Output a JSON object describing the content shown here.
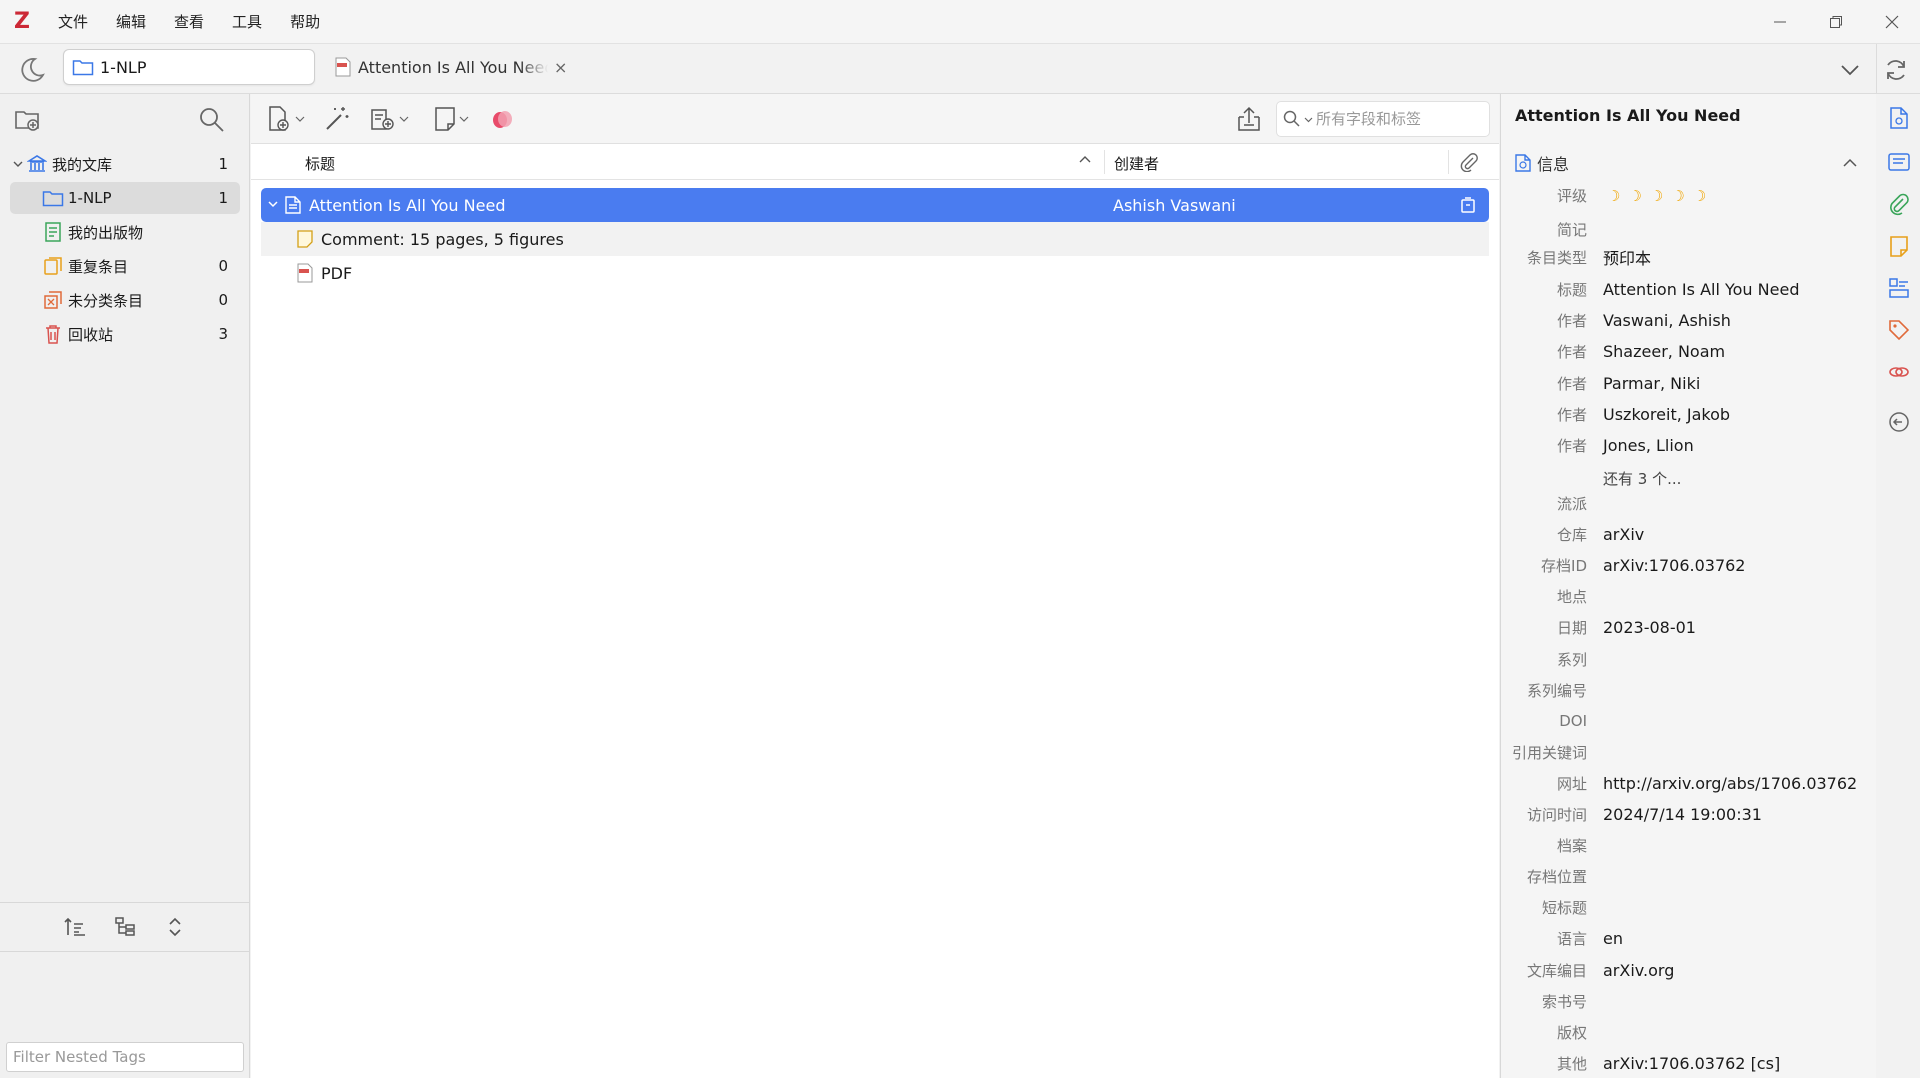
{
  "menubar": {
    "logo": "Z",
    "items": [
      "文件",
      "编辑",
      "查看",
      "工具",
      "帮助"
    ]
  },
  "tabs": {
    "library_tab": "1-NLP",
    "reader_tab": "Attention Is All You Need",
    "close_glyph": "×"
  },
  "collections": [
    {
      "label": "我的文库",
      "count": "1",
      "icon": "library-icon"
    },
    {
      "label": "1-NLP",
      "count": "1",
      "icon": "folder-icon"
    },
    {
      "label": "我的出版物",
      "count": "",
      "icon": "publications-icon"
    },
    {
      "label": "重复条目",
      "count": "0",
      "icon": "duplicates-icon"
    },
    {
      "label": "未分类条目",
      "count": "0",
      "icon": "unfiled-icon"
    },
    {
      "label": "回收站",
      "count": "3",
      "icon": "trash-icon"
    }
  ],
  "tag_filter": {
    "placeholder": "Filter Nested Tags"
  },
  "search": {
    "placeholder": "所有字段和标签"
  },
  "columns": {
    "title": "标题",
    "creator": "创建者"
  },
  "items": {
    "main_title": "Attention Is All You Need",
    "main_creator": "Ashish Vaswani",
    "note_title": "Comment: 15 pages, 5 figures",
    "pdf_title": "PDF"
  },
  "info": {
    "pane_title": "Attention Is All You Need",
    "section_label": "信息",
    "rating_label": "评级",
    "rating_value": 0,
    "more_authors": "还有 3 个...",
    "fields": [
      {
        "label": "简记",
        "value": ""
      },
      {
        "label": "条目类型",
        "value": "预印本"
      },
      {
        "label": "标题",
        "value": "Attention Is All You Need"
      },
      {
        "label": "作者",
        "value": "Vaswani, Ashish"
      },
      {
        "label": "作者",
        "value": "Shazeer, Noam"
      },
      {
        "label": "作者",
        "value": "Parmar, Niki"
      },
      {
        "label": "作者",
        "value": "Uszkoreit, Jakob"
      },
      {
        "label": "作者",
        "value": "Jones, Llion"
      },
      {
        "label": "流派",
        "value": ""
      },
      {
        "label": "仓库",
        "value": "arXiv"
      },
      {
        "label": "存档ID",
        "value": "arXiv:1706.03762"
      },
      {
        "label": "地点",
        "value": ""
      },
      {
        "label": "日期",
        "value": "2023-08-01"
      },
      {
        "label": "系列",
        "value": ""
      },
      {
        "label": "系列编号",
        "value": ""
      },
      {
        "label": "DOI",
        "value": ""
      },
      {
        "label": "引用关键词",
        "value": ""
      },
      {
        "label": "网址",
        "value": "http://arxiv.org/abs/1706.03762"
      },
      {
        "label": "访问时间",
        "value": "2024/7/14 19:00:31"
      },
      {
        "label": "档案",
        "value": ""
      },
      {
        "label": "存档位置",
        "value": ""
      },
      {
        "label": "短标题",
        "value": ""
      },
      {
        "label": "语言",
        "value": "en"
      },
      {
        "label": "文库编目",
        "value": "arXiv.org"
      },
      {
        "label": "索书号",
        "value": ""
      },
      {
        "label": "版权",
        "value": ""
      },
      {
        "label": "其他",
        "value": "arXiv:1706.03762 [cs]"
      }
    ]
  },
  "colors": {
    "accent": "#4a7cf0",
    "logo_red": "#cc2936",
    "folder_blue": "#3b78e7",
    "publications_green": "#3aa55a",
    "duplicates_orange": "#e8a01a",
    "unfiled_orange": "#e06a3a",
    "trash_red": "#d9534f"
  }
}
